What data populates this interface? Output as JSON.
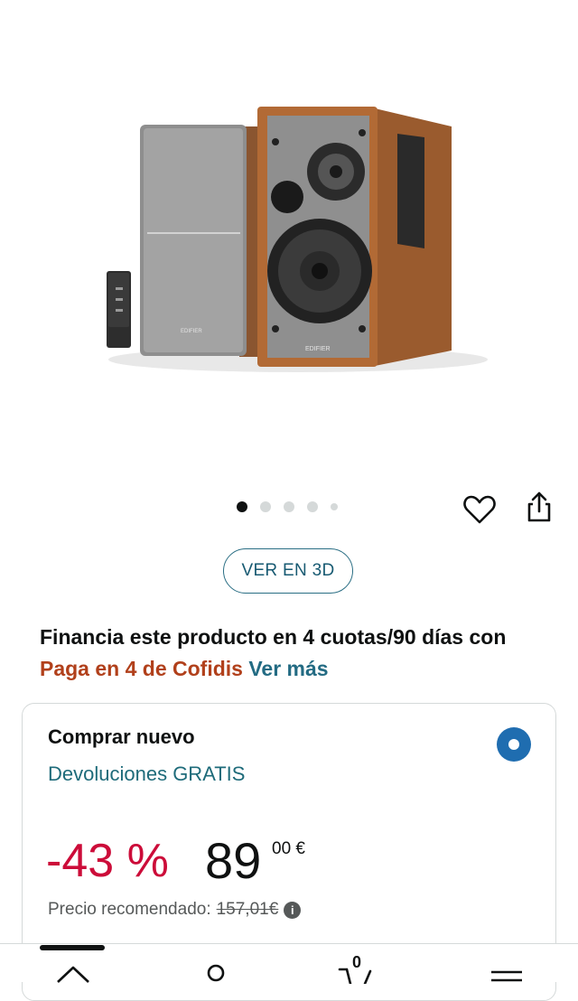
{
  "product": {
    "image_alt": "Edifier speakers",
    "brand_mark": "EDIFIER",
    "image_count": 5,
    "active_image": 1
  },
  "actions": {
    "favorite_icon": "heart-icon",
    "share_icon": "share-icon",
    "view_3d_label": "VER EN 3D"
  },
  "financing": {
    "text": "Financia este producto en 4 cuotas/90 días con ",
    "provider": "Paga en 4 de Cofidis",
    "link": "Ver más"
  },
  "buybox": {
    "title": "Comprar nuevo",
    "returns": "Devoluciones GRATIS",
    "discount": "-43 %",
    "price_whole": "89",
    "price_fraction": "00 €",
    "rrp_label": "Precio recomendado:",
    "rrp_value": "157,01€"
  },
  "nav": {
    "cart_count": "0",
    "icons": [
      "home-icon",
      "account-icon",
      "cart-icon",
      "menu-icon"
    ]
  },
  "colors": {
    "discount": "#cc0c39",
    "link": "#236b83",
    "provider": "#b1401b",
    "radio": "#1f6db0"
  }
}
